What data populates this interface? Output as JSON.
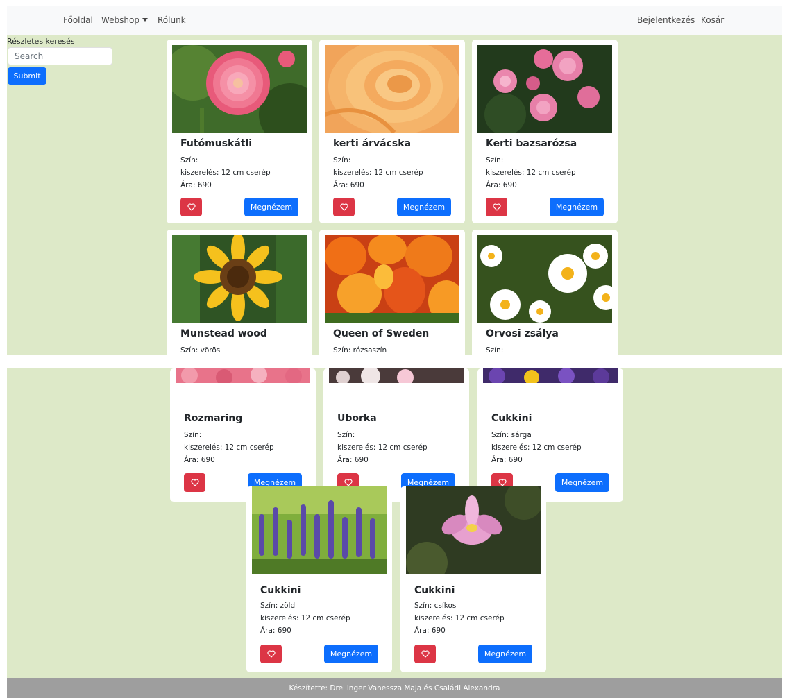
{
  "navbar": {
    "home": "Főoldal",
    "webshop": "Webshop",
    "about": "Rólunk",
    "login": "Bejelentkezés",
    "cart": "Kosár"
  },
  "sidebar": {
    "title": "Részletes keresés",
    "search_placeholder": "Search",
    "submit_label": "Submit"
  },
  "button_label": "Megnézem",
  "products_top": [
    {
      "name": "Futómuskátli",
      "color": "Szín:",
      "package": "kiszerelés: 12 cm cserép",
      "price": "Ára: 690",
      "image": "pink-dahlia"
    },
    {
      "name": "kerti árvácska",
      "color": "Szín:",
      "package": "kiszerelés: 12 cm cserép",
      "price": "Ára: 690",
      "image": "orange-rose"
    },
    {
      "name": "Kerti bazsarózsa",
      "color": "Szín:",
      "package": "kiszerelés: 12 cm cserép",
      "price": "Ára: 690",
      "image": "pink-roses"
    },
    {
      "name": "Munstead wood",
      "color": "Szín: vörös",
      "image": "sunflower"
    },
    {
      "name": "Queen of Sweden",
      "color": "Szín: rózsaszín",
      "image": "orange-tulips"
    },
    {
      "name": "Orvosi zsálya",
      "color": "Szín:",
      "image": "daisies"
    }
  ],
  "products_bottom": [
    {
      "name": "Rozmaring",
      "color": "Szín:",
      "package": "kiszerelés: 12 cm cserép",
      "price": "Ára: 690",
      "image": "pink-flowers"
    },
    {
      "name": "Uborka",
      "color": "Szín:",
      "package": "kiszerelés: 12 cm cserép",
      "price": "Ára: 690",
      "image": "white-flowers"
    },
    {
      "name": "Cukkini",
      "color": "Szín: sárga",
      "package": "kiszerelés: 12 cm cserép",
      "price": "Ára: 690",
      "image": "purple-pansies"
    },
    {
      "name": "Cukkini",
      "color": "Szín: zöld",
      "package": "kiszerelés: 12 cm cserép",
      "price": "Ára: 690",
      "image": "lavender"
    },
    {
      "name": "Cukkini",
      "color": "Szín: csíkos",
      "package": "kiszerelés: 12 cm cserép",
      "price": "Ára: 690",
      "image": "lotus"
    }
  ],
  "footer": "Készítette: Dreilinger Vanessza Maja és Családi Alexandra",
  "colors": {
    "background": "#dde9c8",
    "navbar": "#f8f9fa",
    "primary": "#0d6efd",
    "danger": "#dc3545",
    "footer": "#9e9e9e"
  }
}
